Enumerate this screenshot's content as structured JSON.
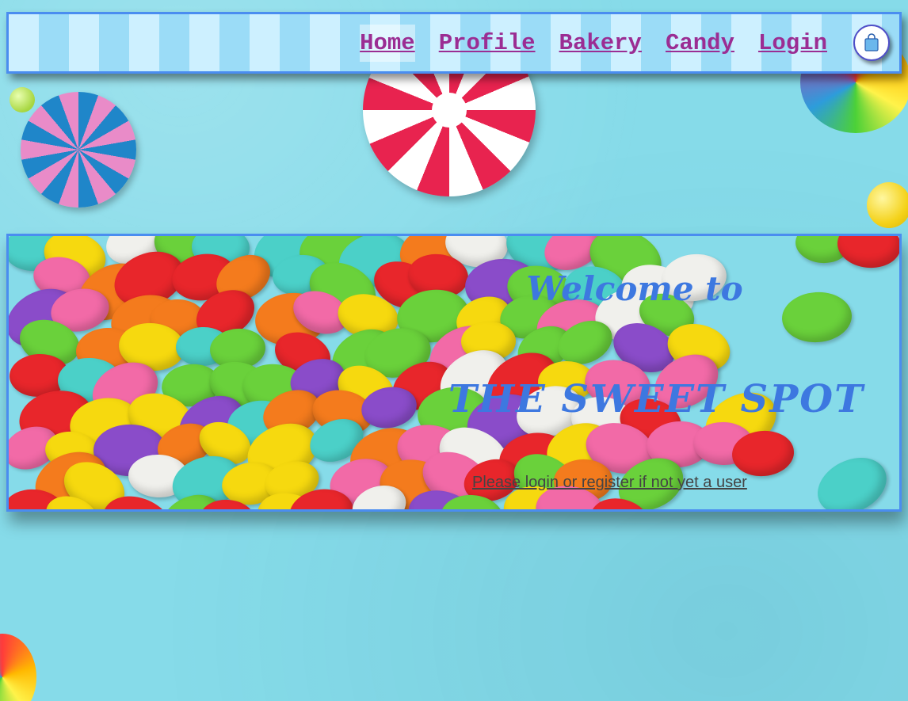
{
  "nav": {
    "links": [
      {
        "label": "Home",
        "active": true
      },
      {
        "label": "Profile",
        "active": false
      },
      {
        "label": "Bakery",
        "active": false
      },
      {
        "label": "Candy",
        "active": false
      },
      {
        "label": "Login",
        "active": false
      }
    ],
    "cart_icon": "shopping-bag-icon"
  },
  "hero": {
    "welcome": "Welcome to",
    "brand": "THE SWEET SPOT",
    "login_prompt": "Please login or register if not yet a user"
  },
  "colors": {
    "accent": "#4a8df0",
    "nav_link": "#9b2d93",
    "hero_text": "#3d78e0",
    "background": "#86dbe9"
  }
}
